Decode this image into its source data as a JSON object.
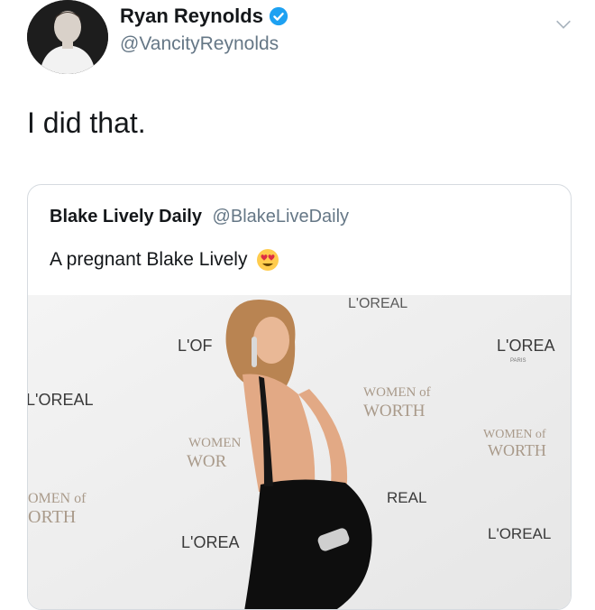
{
  "tweet": {
    "author_name": "Ryan Reynolds",
    "author_handle": "@VancityReynolds",
    "text": "I did that."
  },
  "quoted_tweet": {
    "author_name": "Blake Lively Daily",
    "author_handle": "@BlakeLiveDaily",
    "text": "A pregnant Blake Lively",
    "emoji": "smiling-face-with-heart-eyes"
  },
  "photo_backdrop_text": {
    "loreal_1": "L'OREA",
    "loreal_2": "L'OREAL",
    "loreal_3": "L'OREA",
    "loreal_4": "L'OREAL",
    "loreal_5": "L'OREAL",
    "loreal_6": "L'OF",
    "paris": "PARIS",
    "women_1": "WOMEN of",
    "worth_1": "WORTH",
    "women_2": "WOMEN of",
    "worth_2": "WORTH",
    "women_3": "WOMEN",
    "worth_3": "WOR",
    "women_4": "OMEN of",
    "worth_4": "ORTH",
    "real": "REAL"
  },
  "colors": {
    "verified": "#1da1f2",
    "handle": "#657786",
    "border": "#d6dbe0"
  }
}
